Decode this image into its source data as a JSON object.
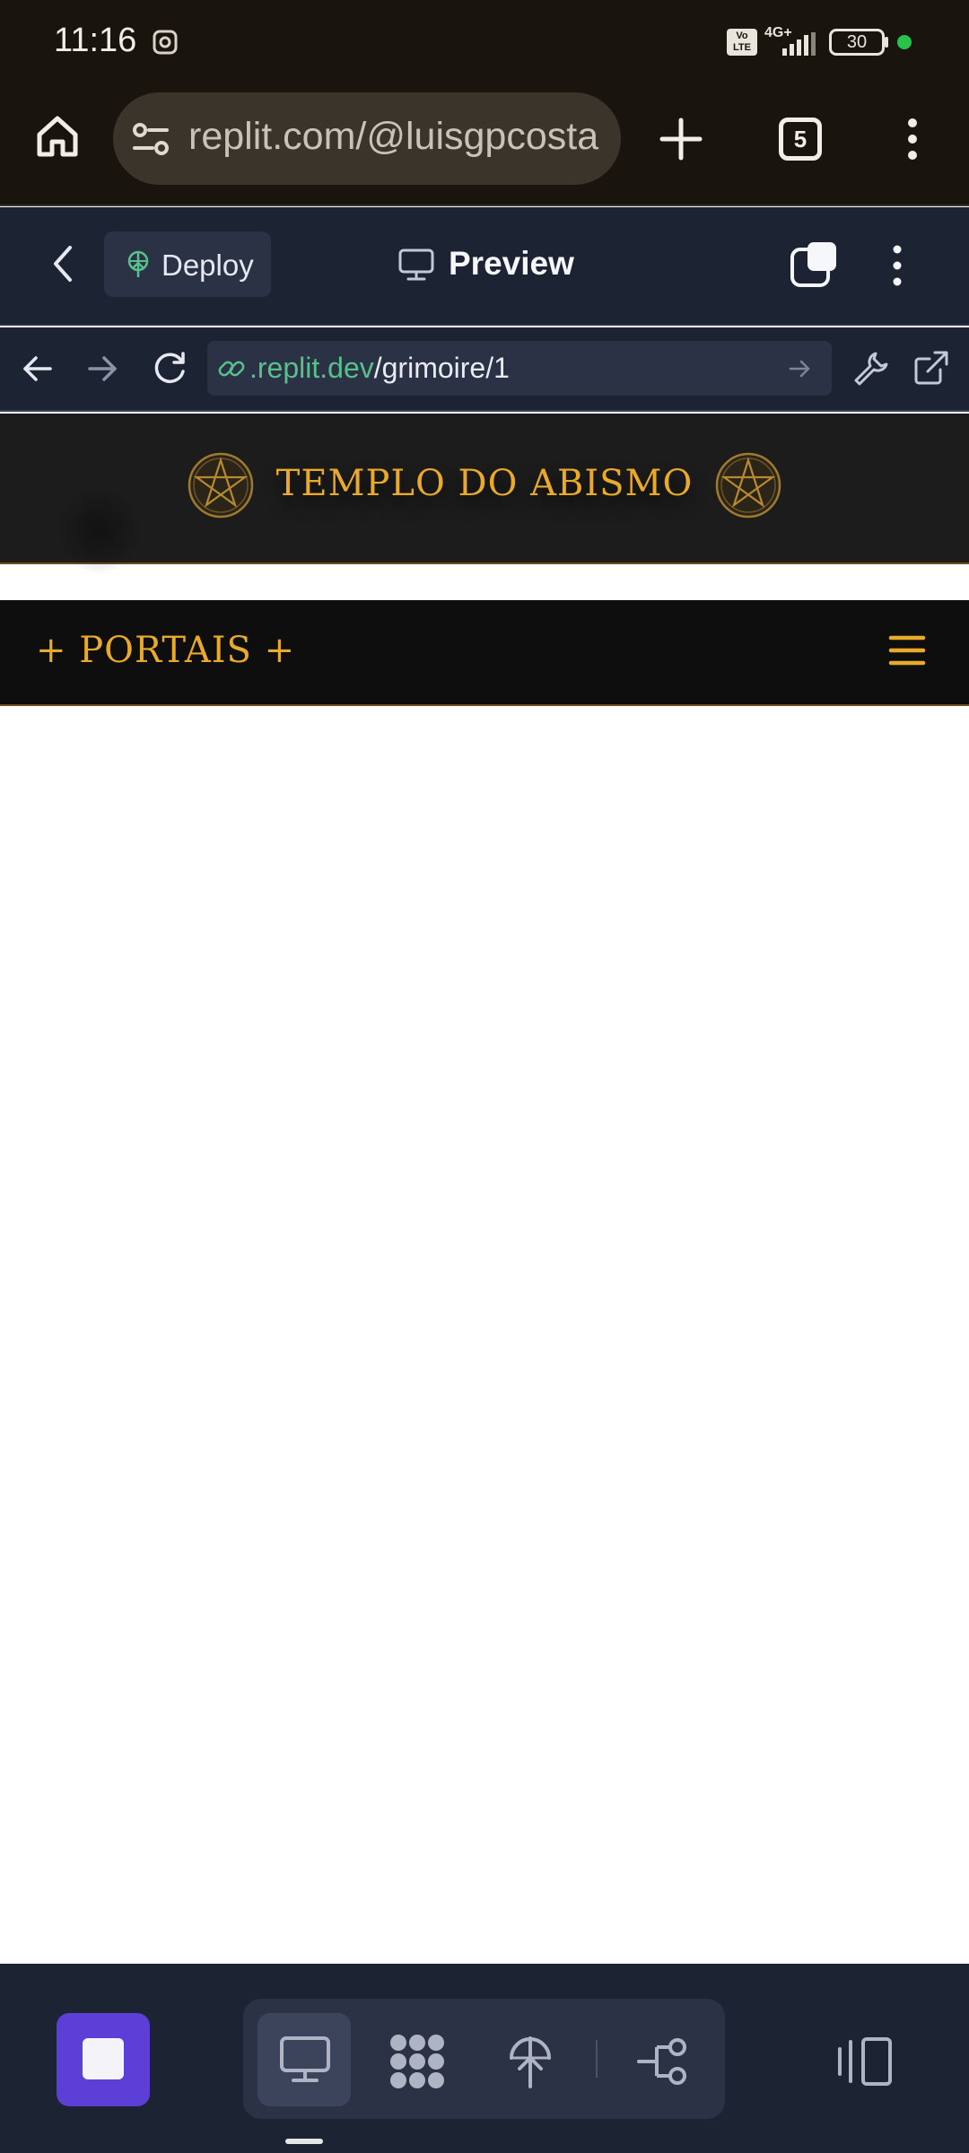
{
  "status_bar": {
    "time": "11:16",
    "network": "4G+",
    "volte": "Vo LTE",
    "battery": "30"
  },
  "browser": {
    "url": "replit.com/@luisgpcosta",
    "tab_count": "5"
  },
  "replit_header": {
    "deploy_label": "Deploy",
    "preview_label": "Preview"
  },
  "replit_nav": {
    "url_host": ".replit.dev",
    "url_path": "/grimoire/1"
  },
  "site": {
    "title": "TEMPLO DO ABISMO",
    "nav_label": "+ PORTAIS +"
  },
  "colors": {
    "chrome_bg": "#1a140f",
    "replit_bg": "#1c2333",
    "site_gold": "#e9a92a",
    "site_dark": "#0e0e0e",
    "accent_purple": "#5b3fd6",
    "link_green": "#58c08a"
  },
  "icons": {
    "home": "home-icon",
    "site_settings": "tune-icon",
    "new_tab": "plus-icon",
    "overflow": "more-vertical-icon",
    "back": "chevron-left-icon",
    "deploy": "deploy-icon",
    "preview": "monitor-icon",
    "nav_back": "arrow-left-icon",
    "nav_forward": "arrow-right-icon",
    "reload": "refresh-icon",
    "link": "link-icon",
    "go": "arrow-right-small-icon",
    "devtools": "wrench-icon",
    "open_external": "external-link-icon",
    "pentagram": "pentagram-icon",
    "menu": "hamburger-menu-icon",
    "stop": "stop-icon",
    "workflow": "workflow-icon",
    "git": "branch-icon",
    "panels": "panels-icon"
  }
}
